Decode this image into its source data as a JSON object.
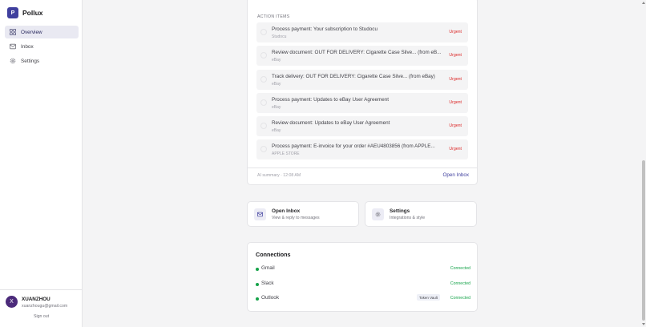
{
  "brand": {
    "logo_letter": "P",
    "name": "Pollux",
    "accent": "#3f3f9e"
  },
  "nav": [
    {
      "label": "Overview",
      "icon": "grid-icon",
      "active": true
    },
    {
      "label": "Inbox",
      "icon": "mail-icon",
      "active": false
    },
    {
      "label": "Settings",
      "icon": "gear-icon",
      "active": false
    }
  ],
  "user": {
    "initial": "X",
    "name": "XUANZHOU",
    "email": "xuanzhougu@gmail.com",
    "signout_label": "Sign out"
  },
  "action_items": {
    "section_label": "ACTION ITEMS",
    "items": [
      {
        "title": "Process payment: Your subscription to Studocu",
        "source": "Studocu",
        "badge": "Urgent"
      },
      {
        "title": "Review document: OUT FOR DELIVERY: Cigarette Case Silve... (from eB...",
        "source": "eBay",
        "badge": "Urgent"
      },
      {
        "title": "Track delivery: OUT FOR DELIVERY: Cigarette Case Silve... (from eBay)",
        "source": "eBay",
        "badge": "Urgent"
      },
      {
        "title": "Process payment: Updates to eBay User Agreement",
        "source": "eBay",
        "badge": "Urgent"
      },
      {
        "title": "Review document: Updates to eBay User Agreement",
        "source": "eBay",
        "badge": "Urgent"
      },
      {
        "title": "Process payment: E-invoice for your order #AEU4803856 (from APPLE...",
        "source": "APPLE STORE",
        "badge": "Urgent"
      }
    ],
    "summary": "AI summary · 12:08 AM",
    "open_inbox_label": "Open Inbox"
  },
  "quick_actions": {
    "inbox": {
      "title": "Open Inbox",
      "subtitle": "View & reply to messages",
      "icon": "mail-icon"
    },
    "settings": {
      "title": "Settings",
      "subtitle": "Integrations & style",
      "icon": "gear-icon"
    }
  },
  "connections": {
    "title": "Connections",
    "items": [
      {
        "name": "Gmail",
        "status": "Connected",
        "tag": ""
      },
      {
        "name": "Slack",
        "status": "Connected",
        "tag": ""
      },
      {
        "name": "Outlook",
        "status": "Connected",
        "tag": "Token Vault"
      }
    ],
    "status_color": "#16a34a"
  },
  "colors": {
    "urgent": "#dc2626",
    "background": "#f4f4f5"
  }
}
